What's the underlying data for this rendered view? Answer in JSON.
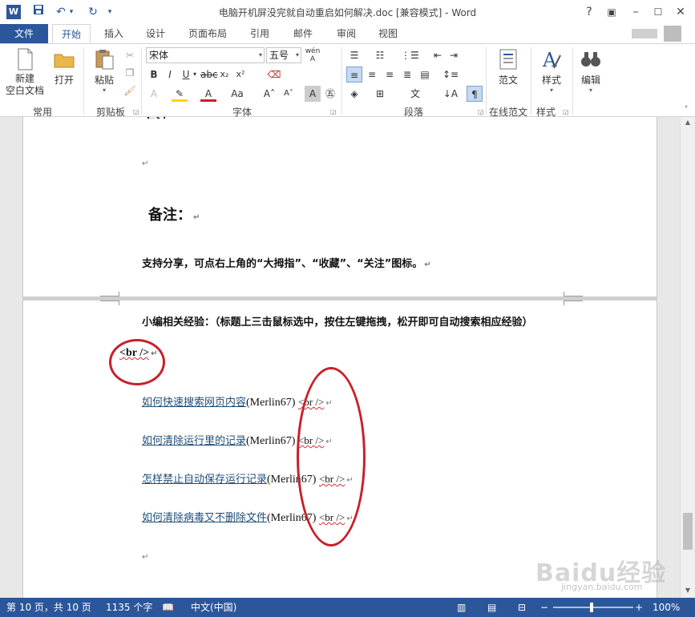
{
  "window": {
    "title": "电脑开机屏没完就自动重启如何解决.doc [兼容模式] - Word",
    "word_icon": "W",
    "help": "?",
    "controls": [
      "restore-ribbon",
      "minimize",
      "maximize",
      "close"
    ]
  },
  "tabs": {
    "file": "文件",
    "items": [
      "开始",
      "插入",
      "设计",
      "页面布局",
      "引用",
      "邮件",
      "审阅",
      "视图"
    ],
    "active": "开始"
  },
  "ribbon": {
    "groups": {
      "common": "常用",
      "clipboard": "剪贴板",
      "font": "字体",
      "paragraph": "段落",
      "online": "在线范文",
      "styles": "样式"
    },
    "new_blank": "新建\n空白文档",
    "open": "打开",
    "paste": "粘贴",
    "font_name": "宋体",
    "font_size": "五号",
    "sample": "范文",
    "styles_btn": "样式",
    "edit_btn": "编辑"
  },
  "document": {
    "page1": {
      "note_title": "备注：",
      "share_text": "支持分享，可点右上角的“大拇指”、“收藏”、“关注”图标。"
    },
    "page2": {
      "related_title": "小编相关经验：（标题上三击鼠标选中，按住左键拖拽，松开即可自动搜索相应经验）",
      "br_tag": "<br />",
      "links": [
        {
          "text": "如何快速搜索网页内容",
          "suffix": "(Merlin67)",
          "tag": "<br />"
        },
        {
          "text": "如何清除运行里的记录",
          "suffix": "(Merlin67)",
          "tag": "<br />"
        },
        {
          "text": "怎样禁止自动保存运行记录",
          "suffix": "(Merlin67)",
          "tag": "<br />"
        },
        {
          "text": "如何清除病毒又不删除文件",
          "suffix": "(Merlin67)",
          "tag": "<br />"
        }
      ]
    }
  },
  "status": {
    "page": "第 10 页，共 10 页",
    "words": "1135 个字",
    "lang": "中文(中国)",
    "zoom": "100%",
    "zoom_level": 1.0
  },
  "watermark": {
    "brand": "Baidu经验",
    "url": "jingyan.baidu.com"
  },
  "colors": {
    "accent": "#2b579a",
    "link": "#1f4e79",
    "annotation": "#c8202a"
  }
}
